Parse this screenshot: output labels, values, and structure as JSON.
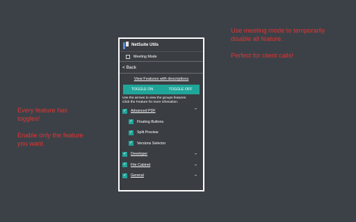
{
  "notes": {
    "top_right": [
      "Use meeting mode to temporarily",
      "disable all feature.",
      "",
      "Perfect for client calls!"
    ],
    "left": [
      "Every feature has",
      "toggles!",
      "",
      "Enable only the feature",
      "you want."
    ]
  },
  "panel": {
    "app_title": "NetSuite Utils",
    "meeting_mode_label": "Meeting Mode",
    "back_label": "< Back",
    "view_link": "View Features with descriptions",
    "toggle_on": "TOGGLE ON",
    "toggle_off": "TOGGLE OFF",
    "hint_line1": "Use the arrows to view the groups features.",
    "hint_line2": "Click the Feature for more infomation.",
    "features": [
      {
        "label": "Advanced PDF",
        "checked": true,
        "chevron": "up"
      },
      {
        "label": "Floating Buttons",
        "checked": true,
        "sub": true
      },
      {
        "label": "Split Preview",
        "checked": true,
        "sub": true
      },
      {
        "label": "Versions Selector",
        "checked": true,
        "sub": true
      },
      {
        "label": "Developer",
        "checked": true,
        "chevron": "down"
      },
      {
        "label": "File Cabinet",
        "checked": true,
        "chevron": "down"
      },
      {
        "label": "General",
        "checked": true,
        "chevron": "down"
      }
    ]
  },
  "colors": {
    "background": "#3c4148",
    "accent": "#20a59a",
    "note_text": "#e8332f"
  }
}
